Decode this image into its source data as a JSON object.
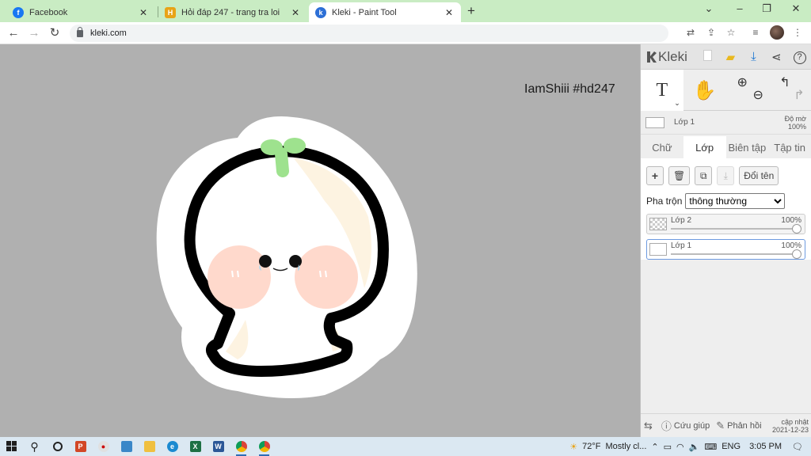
{
  "browser": {
    "tabs": [
      {
        "label": "Facebook",
        "favicon": "facebook-icon",
        "color": "#1877f2",
        "active": false
      },
      {
        "label": "Hỏi đáp 247 - trang tra loi",
        "favicon": "hoidap-icon",
        "color": "#e8a317",
        "active": false
      },
      {
        "label": "Kleki - Paint Tool",
        "favicon": "kleki-icon",
        "color": "#2d6fd6",
        "active": true
      }
    ],
    "url": "kleki.com",
    "tab_bar_color": "#c9ecc3"
  },
  "canvas": {
    "watermark": "IamShiii #hd247",
    "background_color": "#b0b0b0"
  },
  "panel": {
    "logo": "Kleki",
    "tools": [
      "text-tool",
      "hand-tool",
      "zoom-tool",
      "undo-redo"
    ],
    "text_tool_glyph": "T",
    "current_layer": {
      "name": "Lớp 1",
      "opacity_label": "Độ mờ",
      "opacity_value": "100%"
    },
    "tabs": [
      {
        "label": "Chữ",
        "selected": false
      },
      {
        "label": "Lớp",
        "selected": true
      },
      {
        "label": "Biên tập",
        "selected": false
      },
      {
        "label": "Tập tin",
        "selected": false
      }
    ],
    "rename_label": "Đổi tên",
    "blend_label": "Pha trộn",
    "blend_value": "thông thường",
    "layers": [
      {
        "name": "Lớp 2",
        "opacity": "100%",
        "selected": false
      },
      {
        "name": "Lớp 1",
        "opacity": "100%",
        "selected": true
      }
    ],
    "bottom": {
      "help": "Cứu giúp",
      "feedback": "Phản hồi",
      "update_label": "cập nhật",
      "update_date": "2021-12-23"
    }
  },
  "taskbar": {
    "weather_temp": "72°F",
    "weather_text": "Mostly cl...",
    "language": "ENG",
    "time": "3:05 PM"
  }
}
